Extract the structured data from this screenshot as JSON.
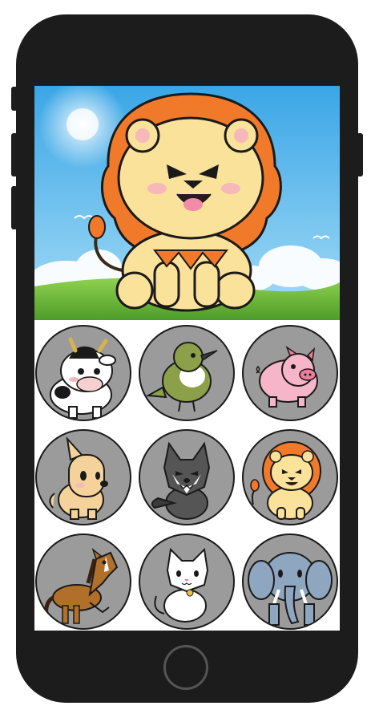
{
  "app": {
    "featured_animal": "lion",
    "hero_sky_color": "#5ab3e8",
    "grass_color": "#7cc843"
  },
  "animals": [
    {
      "name": "cow",
      "icon": "cow-icon"
    },
    {
      "name": "bird",
      "icon": "bird-icon"
    },
    {
      "name": "pig",
      "icon": "pig-icon"
    },
    {
      "name": "dog",
      "icon": "dog-icon"
    },
    {
      "name": "wolf",
      "icon": "wolf-icon"
    },
    {
      "name": "lion",
      "icon": "lion-icon"
    },
    {
      "name": "horse",
      "icon": "horse-icon"
    },
    {
      "name": "cat",
      "icon": "cat-icon"
    },
    {
      "name": "elephant",
      "icon": "elephant-icon"
    }
  ],
  "colors": {
    "tile_bg": "#9b9b9b",
    "phone_body": "#1c1c1c"
  }
}
